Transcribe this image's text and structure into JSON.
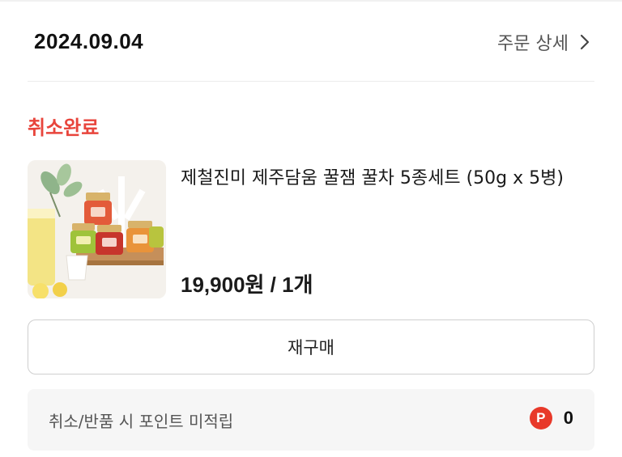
{
  "order": {
    "date": "2024.09.04",
    "detail_label": "주문 상세",
    "status": "취소완료",
    "colors": {
      "status": "#e8453c",
      "points_badge": "#e8392a"
    }
  },
  "product": {
    "name": "제철진미 제주담움 꿀잼 꿀차 5종세트 (50g x 5병)",
    "price_line": "19,900원 / 1개",
    "image_icon": "honey-jam-set-photo"
  },
  "actions": {
    "rebuy_label": "재구매"
  },
  "points": {
    "label": "취소/반품 시 포인트 미적립",
    "badge": "P",
    "value": "0"
  }
}
